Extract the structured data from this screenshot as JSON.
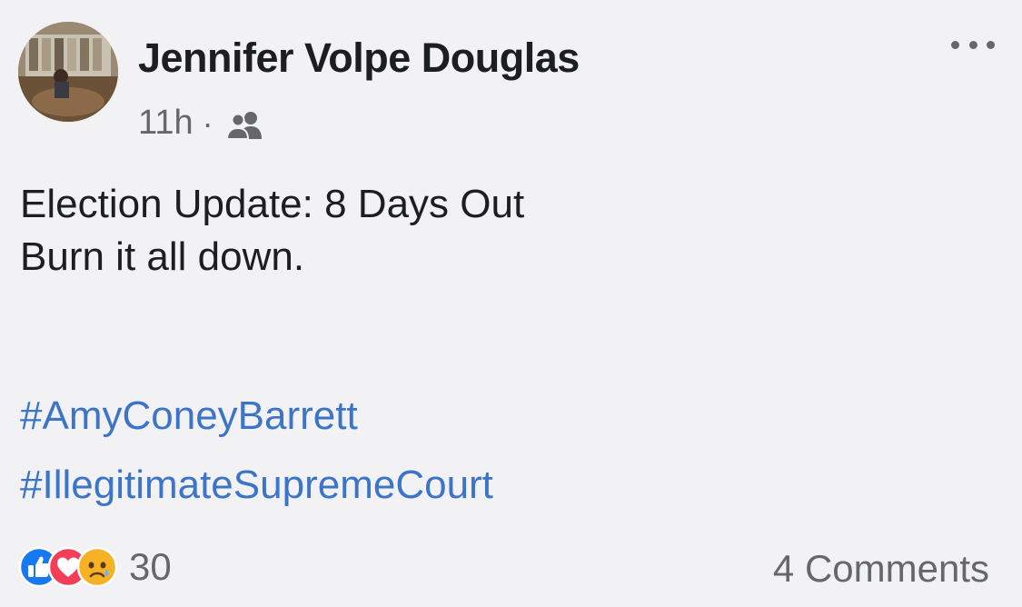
{
  "post": {
    "author_name": "Jennifer Volpe Douglas",
    "timestamp": "11h",
    "separator": "·",
    "audience_icon": "friends-icon",
    "more_icon": "more-options-icon",
    "body_lines": [
      "Election Update: 8 Days Out",
      "Burn it all down."
    ],
    "hashtags": [
      "#AmyConeyBarrett",
      "#IllegitimateSupremeCourt"
    ],
    "reaction_icons": [
      "like-reaction-icon",
      "love-reaction-icon",
      "sad-reaction-icon"
    ],
    "reaction_count": "30",
    "comments_label": "4 Comments"
  },
  "colors": {
    "background": "#f2f2f4",
    "text": "#1c1e21",
    "secondary_text": "#65676b",
    "hashtag": "#3b74c8",
    "like": "#1877f2",
    "love": "#f33e58",
    "sad": "#f7b125"
  }
}
